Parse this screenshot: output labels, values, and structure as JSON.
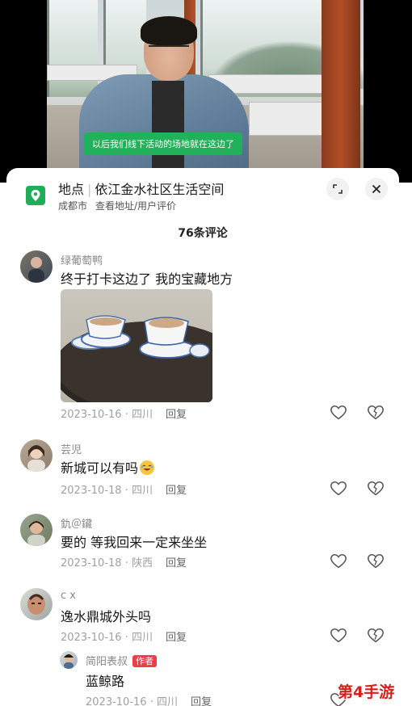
{
  "video": {
    "subtitle": "以后我们线下活动的场地就在这边了"
  },
  "location": {
    "label": "地点",
    "name": "依江金水社区生活空间",
    "city": "成都市",
    "links": "查看地址/用户评价"
  },
  "comments_count": "76条评论",
  "comments": [
    {
      "user": "绿葡萄鸭",
      "text": "终于打卡这边了 我的宝藏地方",
      "date": "2023-10-16",
      "region": "四川",
      "reply": "回复"
    },
    {
      "user": "芸児",
      "text": "新城可以有吗",
      "date": "2023-10-18",
      "region": "四川",
      "reply": "回复"
    },
    {
      "user": "釚＠鑶",
      "text": "要的 等我回来一定来坐坐",
      "date": "2023-10-18",
      "region": "陕西",
      "reply": "回复"
    },
    {
      "user": "c x",
      "text": "逸水鼎城外头吗",
      "date": "2023-10-16",
      "region": "四川",
      "reply": "回复"
    }
  ],
  "reply_comment": {
    "user": "简阳表叔",
    "badge": "作者",
    "text": "蓝鲸路",
    "date": "2023-10-16",
    "region": "四川",
    "reply": "回复"
  },
  "watermark": "第4手游",
  "icons": {
    "location": "location-pin-icon",
    "expand": "expand-icon",
    "close": "close-icon",
    "like": "heart-icon",
    "dislike": "broken-heart-icon",
    "emoji": "laughing-emoji-icon"
  },
  "colors": {
    "accent_green": "#1fad58",
    "author_badge": "#f23a4a",
    "watermark": "#d8201a"
  }
}
